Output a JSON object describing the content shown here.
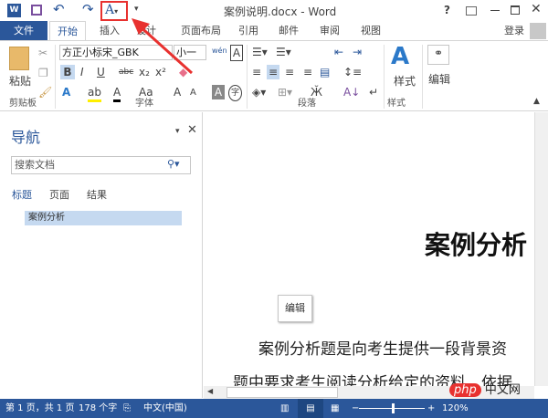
{
  "window": {
    "title": "案例说明.docx - Word",
    "help": "?",
    "signin": "登录"
  },
  "qat": {
    "icons": [
      "word-logo",
      "save",
      "undo",
      "redo",
      "text-effects",
      "customize"
    ]
  },
  "tabs": [
    {
      "label": "文件"
    },
    {
      "label": "开始"
    },
    {
      "label": "插入"
    },
    {
      "label": "设计"
    },
    {
      "label": "页面布局"
    },
    {
      "label": "引用"
    },
    {
      "label": "邮件"
    },
    {
      "label": "审阅"
    },
    {
      "label": "视图"
    }
  ],
  "ribbon": {
    "paste": "粘贴",
    "font_name": "方正小标宋_GBK",
    "font_size": "小一",
    "groups": {
      "clipboard": "剪贴板",
      "font": "字体",
      "paragraph": "段落",
      "styles": "样式"
    },
    "styles_btn": "样式",
    "edit_btn": "编辑",
    "font_btns": {
      "bold": "B",
      "italic": "I",
      "underline": "U",
      "strike": "abc",
      "sub": "x₂",
      "sup": "x²",
      "case": "Aa",
      "grow": "A",
      "shrink": "A",
      "char_shade": "A",
      "enclose": "字",
      "phonetic": "wén",
      "border": "A"
    }
  },
  "nav": {
    "title": "导航",
    "search_placeholder": "搜索文档",
    "tabs": [
      "标题",
      "页面",
      "结果"
    ],
    "headings": [
      "案例分析"
    ]
  },
  "doc": {
    "title": "案例分析",
    "tooltip": "编辑",
    "lines": [
      "案例分析题是向考生提供一段背景资",
      "题中要求考生阅读分析给定的资料，依据"
    ]
  },
  "status": {
    "page": "第 1 页，共 1 页",
    "words": "178 个字",
    "lang": "中文(中国)",
    "zoom": "120%",
    "zoom_level": 120
  },
  "colors": {
    "accent": "#2b579a",
    "highlight": "#e8312f"
  },
  "watermark": "php中文网"
}
